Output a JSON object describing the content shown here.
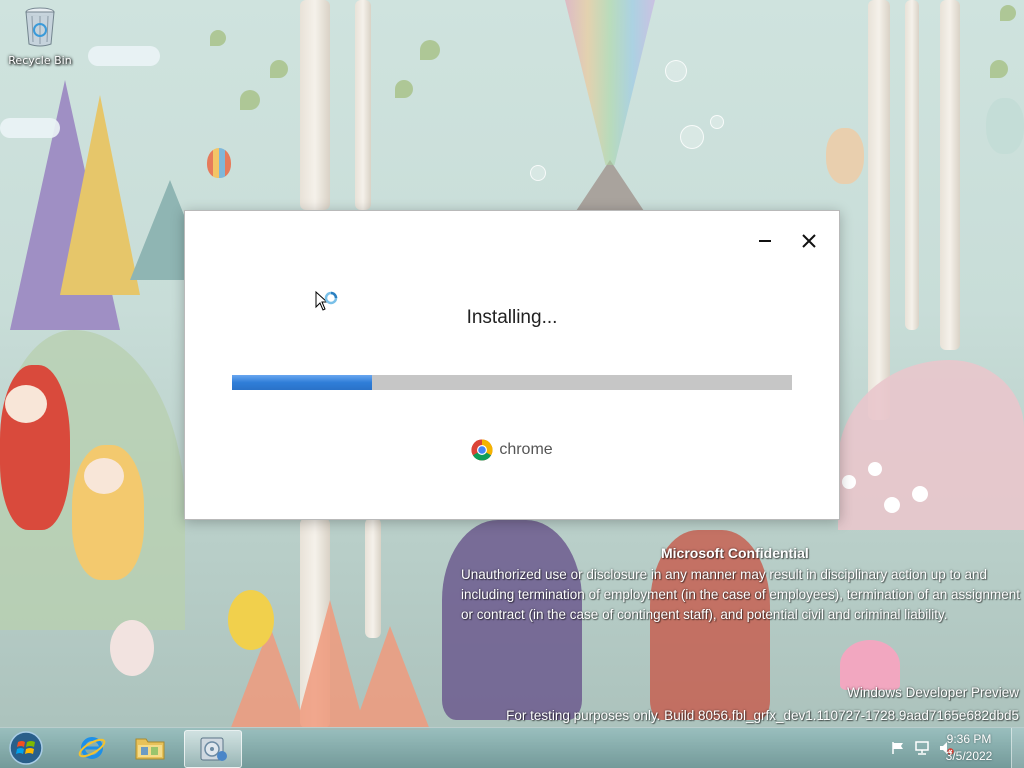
{
  "desktop": {
    "recycle_bin_label": "Recycle Bin"
  },
  "installer": {
    "status": "Installing...",
    "progress": 0.25,
    "brand": "chrome",
    "accent_color": "#2f7ed8"
  },
  "watermark": {
    "title": "Microsoft Confidential",
    "body": "Unauthorized use or disclosure in any manner may result in disciplinary action up to and including termination of employment (in the case of employees), termination of an assignment or contract (in the case of contingent staff), and potential civil and criminal liability.",
    "edition": "Windows Developer Preview",
    "build": "For testing purposes only. Build 8056.fbl_grfx_dev1.110727-1728.9aad7165e682dbd5"
  },
  "taskbar": {
    "pinned": [
      {
        "name": "internet-explorer",
        "icon": "ie-icon"
      },
      {
        "name": "windows-explorer",
        "icon": "folder-icon"
      },
      {
        "name": "chrome-installer",
        "icon": "installer-icon",
        "active": true
      }
    ],
    "tray_icons": [
      "flag-icon",
      "network-icon",
      "volume-muted-icon"
    ],
    "clock_time": "9:36 PM",
    "clock_date": "3/5/2022"
  }
}
